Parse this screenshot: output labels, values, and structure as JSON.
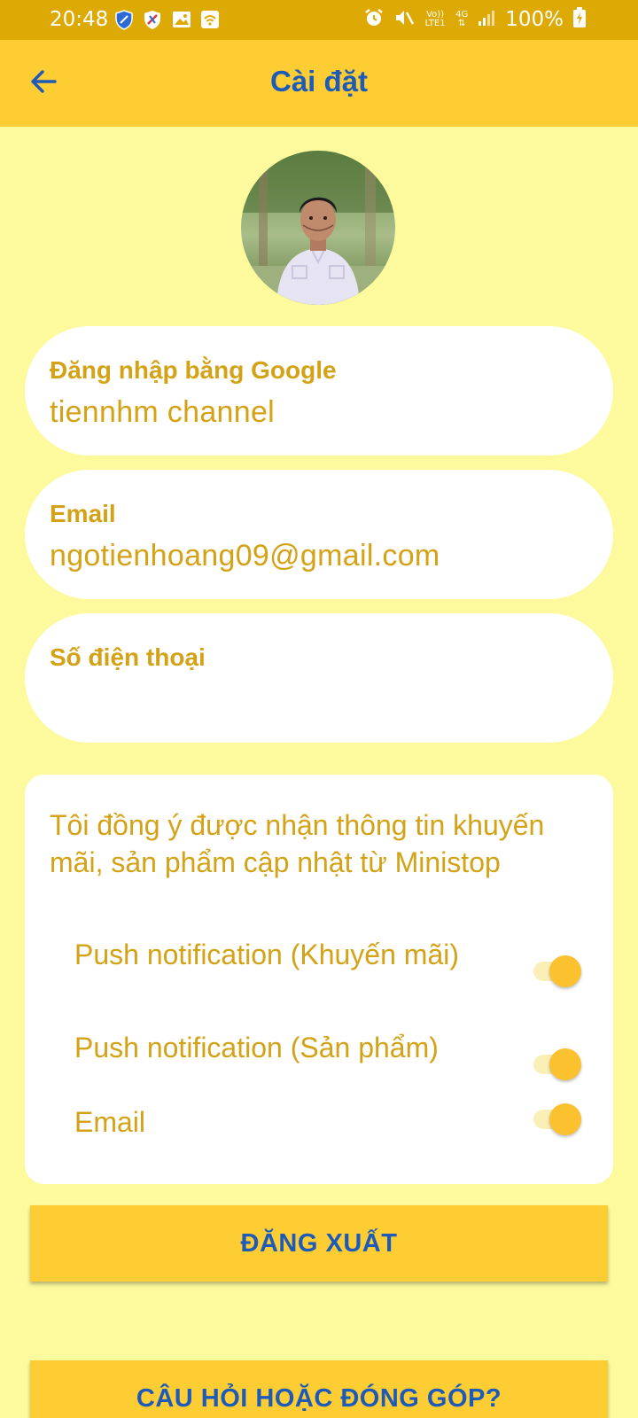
{
  "status_bar": {
    "time": "20:48",
    "battery_percent": "100%",
    "network_type": "4G",
    "volte_label": "Vo)) LTE1",
    "left_icons": [
      "shield-icon",
      "shield-icon",
      "image-icon",
      "wifi-icon"
    ],
    "right_icons": [
      "alarm-icon",
      "mute-icon",
      "volte-icon",
      "data-arrows-icon",
      "signal-icon",
      "battery-charging-icon"
    ]
  },
  "app_bar": {
    "title": "Cài đặt",
    "back_icon": "arrow-left-icon"
  },
  "profile": {
    "avatar": "user-photo"
  },
  "fields": {
    "google": {
      "label": "Đăng nhập bằng Google",
      "value": "tiennhm channel"
    },
    "email": {
      "label": "Email",
      "value": "ngotienhoang09@gmail.com"
    },
    "phone": {
      "label": "Số điện thoại",
      "value": ""
    }
  },
  "consent": {
    "text": "Tôi đồng ý được nhận thông tin khuyến mãi, sản phẩm cập nhật từ Ministop",
    "preferences": [
      {
        "label": "Push notification (Khuyến mãi)",
        "enabled": true
      },
      {
        "label": "Push notification (Sản phẩm)",
        "enabled": true
      },
      {
        "label": "Email",
        "enabled": true
      }
    ]
  },
  "buttons": {
    "logout": "ĐĂNG XUẤT",
    "feedback": "CÂU HỎI HOẶC ĐÓNG GÓP?"
  },
  "colors": {
    "status_bar": "#DDA904",
    "app_bar": "#FDCD33",
    "background": "#FCFA9D",
    "title_blue": "#1E5BB8",
    "text_gold": "#D4A216",
    "toggle_on": "#FBC12E"
  }
}
